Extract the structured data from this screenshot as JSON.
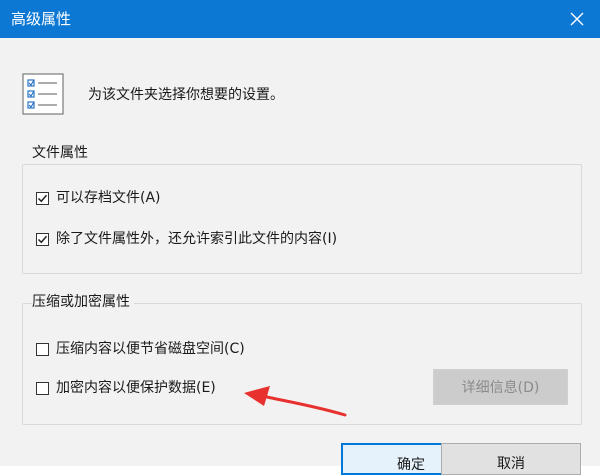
{
  "window": {
    "title": "高级属性"
  },
  "dialog": {
    "description": "为该文件夹选择你想要的设置。"
  },
  "file_attributes": {
    "legend": "文件属性",
    "options": [
      {
        "label": "可以存档文件(A)",
        "checked": true
      },
      {
        "label": "除了文件属性外，还允许索引此文件的内容(I)",
        "checked": true
      }
    ]
  },
  "compress_encrypt": {
    "legend": "压缩或加密属性",
    "options": [
      {
        "label": "压缩内容以便节省磁盘空间(C)",
        "checked": false
      },
      {
        "label": "加密内容以便保护数据(E)",
        "checked": false
      }
    ],
    "details_button": "详细信息(D)"
  },
  "buttons": {
    "ok": "确定",
    "cancel": "取消"
  },
  "colors": {
    "titlebar": "#0c78d4",
    "annotation_arrow": "#e8312f",
    "focus_border": "#0078d7"
  }
}
